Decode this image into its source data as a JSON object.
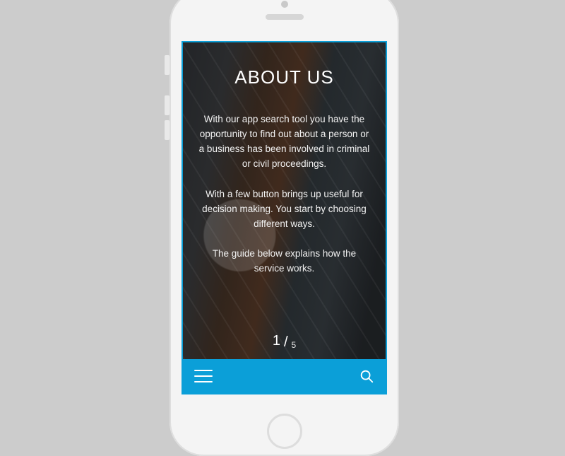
{
  "page": {
    "title": "ABOUT US",
    "paragraphs": [
      "With our app search tool you have the opportunity to find out about a person or a business has been involved in criminal or civil proceedings.",
      "With a few button brings up useful for decision making. You start by choosing different ways.",
      "The guide below explains how the service works."
    ],
    "pager": {
      "current": "1",
      "separator": "/",
      "total": "5"
    }
  },
  "toolbar": {
    "menu_label": "Menu",
    "search_label": "Search"
  },
  "colors": {
    "accent": "#0b9fd8",
    "page_bg": "#cccccc"
  }
}
